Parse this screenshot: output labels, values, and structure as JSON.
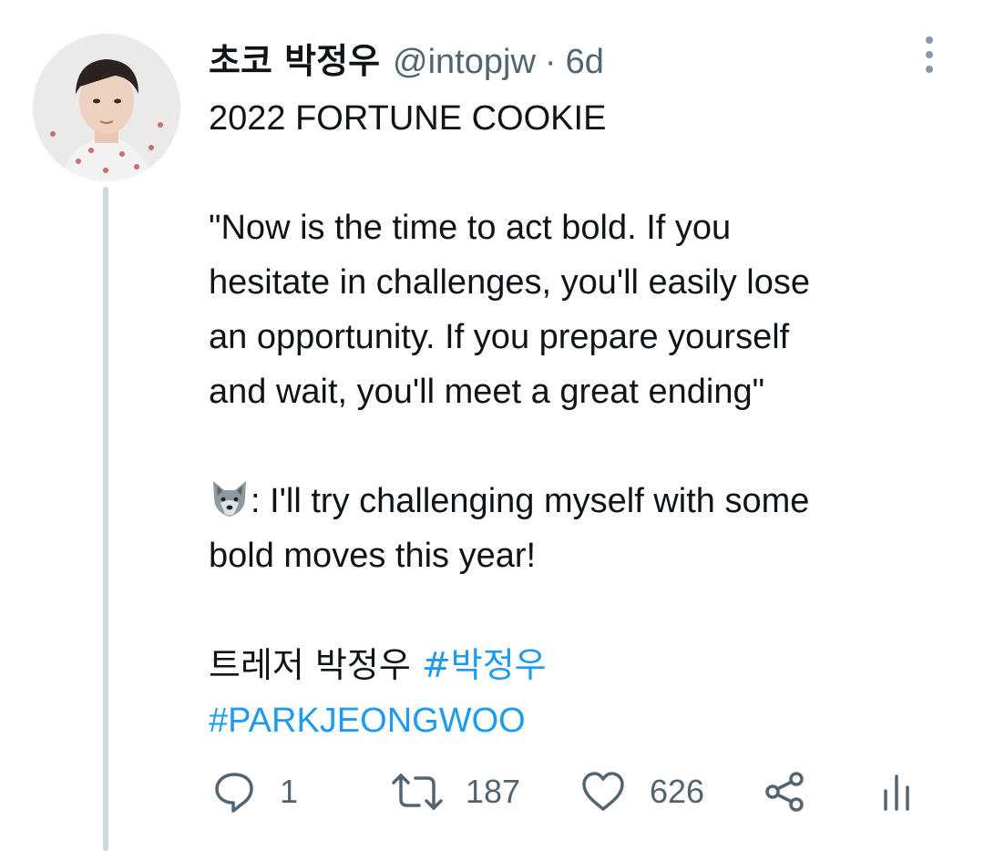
{
  "tweet": {
    "display_name": "초코 박정우",
    "handle": "@intopjw",
    "separator": "·",
    "time": "6d",
    "lines": {
      "l1": "2022 FORTUNE COOKIE",
      "l2": "\"Now is the time to act bold. If you",
      "l3": "hesitate in challenges, you'll easily lose",
      "l4": "an opportunity. If you prepare yourself",
      "l5": "and wait, you'll meet a great ending\"",
      "l6": ": I'll try challenging myself with some",
      "l7": "bold moves this year!",
      "l8_text": "트레저 박정우 ",
      "hashtag1": "#박정우",
      "hashtag2": "#PARKJEONGWOO"
    },
    "emoji_icon": "wolf-emoji-icon"
  },
  "actions": {
    "reply_count": "1",
    "retweet_count": "187",
    "like_count": "626"
  },
  "icons": [
    "more-options-icon",
    "reply-icon",
    "retweet-icon",
    "like-icon",
    "share-icon",
    "analytics-icon"
  ],
  "colors": {
    "text": "#0f1419",
    "secondary": "#536471",
    "link": "#1d9bf0",
    "thread_line": "#cfd9de"
  }
}
